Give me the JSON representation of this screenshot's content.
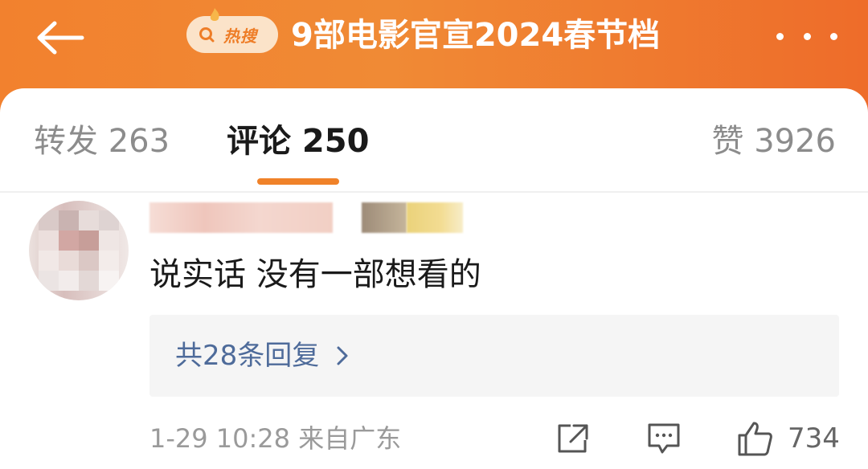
{
  "header": {
    "hot_label": "热搜",
    "title": "9部电影官宣2024春节档"
  },
  "tabs": {
    "repost": "转发 263",
    "comment": "评论 250",
    "like": "赞 3926"
  },
  "comment": {
    "text": "说实话 没有一部想看的",
    "replies_link": "共28条回复",
    "meta": "1-29 10:28 来自广东",
    "like_count": "734"
  },
  "colors": {
    "header_orange": "#f08a35",
    "tab_indicator": "#f08229",
    "reply_link_blue": "#4e6b9a"
  },
  "icons": [
    "back-arrow-icon",
    "search-icon",
    "flame-icon",
    "more-icon",
    "chevron-right-icon",
    "share-icon",
    "comment-icon",
    "thumbs-up-icon"
  ]
}
